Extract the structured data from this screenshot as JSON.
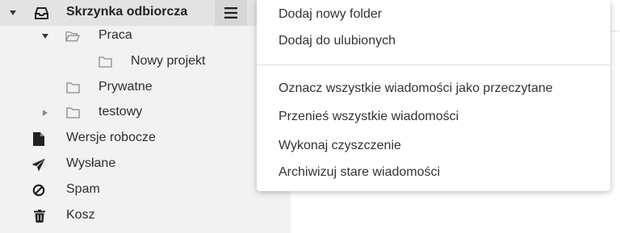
{
  "folders": {
    "inbox_label": "Skrzynka odbiorcza",
    "inbox_icon": "inbox-tray-icon",
    "menu_icon": "hamburger-menu-icon",
    "items": [
      {
        "label": "Praca",
        "icon": "folder-open-icon",
        "expander": "expanded"
      },
      {
        "label": "Nowy projekt",
        "icon": "folder-icon"
      },
      {
        "label": "Prywatne",
        "icon": "folder-icon"
      },
      {
        "label": "testowy",
        "icon": "folder-icon",
        "expander": "collapsed"
      },
      {
        "label": "Wersje robocze",
        "icon": "document-icon"
      },
      {
        "label": "Wysłane",
        "icon": "paper-plane-icon"
      },
      {
        "label": "Spam",
        "icon": "ban-icon"
      },
      {
        "label": "Kosz",
        "icon": "trash-icon"
      }
    ]
  },
  "dropdown": {
    "group1": [
      "Dodaj nowy folder",
      "Dodaj do ulubionych"
    ],
    "group2": [
      "Oznacz wszystkie wiadomości jako przeczytane",
      "Przenieś wszystkie wiadomości",
      "Wykonaj czyszczenie",
      "Archiwizuj stare wiadomości"
    ]
  },
  "colors": {
    "sidebar_bg": "#f2f2f2",
    "selected_row_bg": "#e3e3e3",
    "menu_button_bg": "#d6d6d6",
    "text": "#2d2d2d"
  }
}
